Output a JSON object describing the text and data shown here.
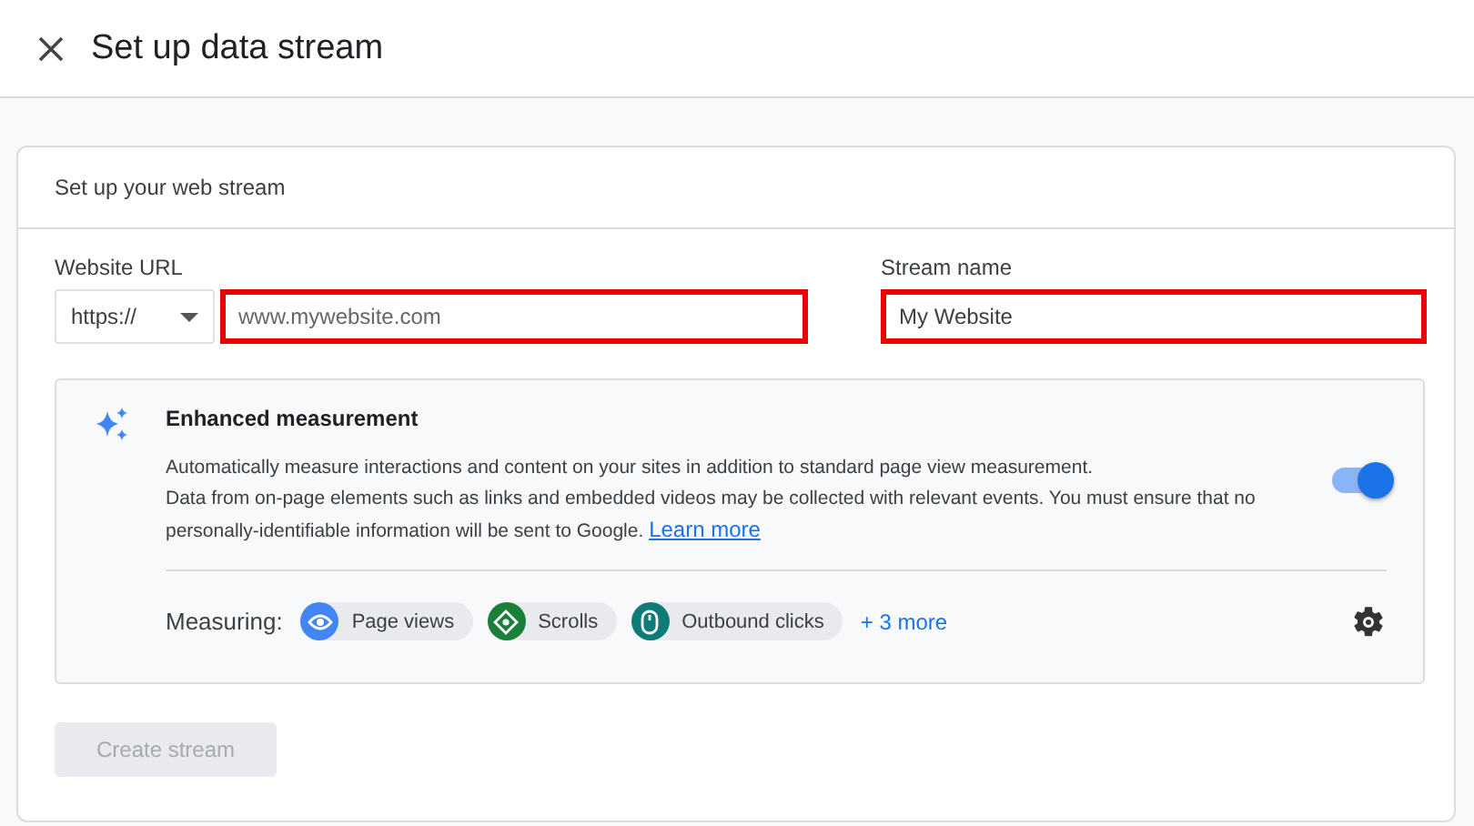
{
  "header": {
    "title": "Set up data stream"
  },
  "card": {
    "title": "Set up your web stream",
    "website_url": {
      "label": "Website URL",
      "protocol": "https://",
      "placeholder": "www.mywebsite.com",
      "highlighted": true
    },
    "stream_name": {
      "label": "Stream name",
      "value": "My Website",
      "highlighted": true
    },
    "enhanced": {
      "title": "Enhanced measurement",
      "line1": "Automatically measure interactions and content on your sites in addition to standard page view measurement.",
      "line2": "Data from on-page elements such as links and embedded videos may be collected with relevant events. You must ensure that no personally-identifiable information will be sent to Google.",
      "link": "Learn more",
      "on": true,
      "measuring_label": "Measuring:",
      "chips": [
        {
          "label": "Page views",
          "kind": "eye",
          "color": "#4285f4"
        },
        {
          "label": "Scrolls",
          "kind": "scroll",
          "color": "#188038"
        },
        {
          "label": "Outbound clicks",
          "kind": "mouse",
          "color": "#0f7b78"
        }
      ],
      "more": "+ 3 more"
    },
    "create_button": {
      "label": "Create stream",
      "disabled": true
    }
  }
}
